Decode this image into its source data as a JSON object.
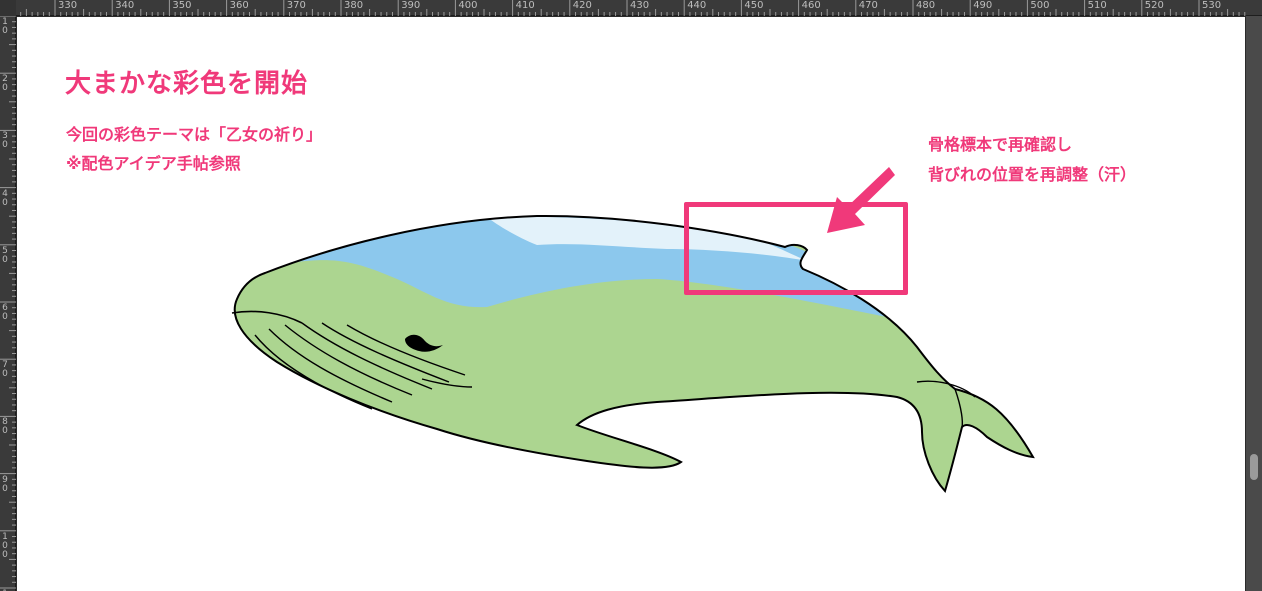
{
  "ruler": {
    "top_labels": [
      "330",
      "340",
      "350",
      "360",
      "370",
      "380",
      "390",
      "400",
      "410",
      "420",
      "430",
      "440",
      "450",
      "460",
      "470",
      "480",
      "490",
      "500",
      "510",
      "520",
      "530"
    ],
    "left_labels": [
      "1\n0",
      "2\n0",
      "3\n0",
      "4\n0",
      "5\n0",
      "6\n0",
      "7\n0",
      "8\n0",
      "9\n0",
      "1\n0\n0",
      "1\n1"
    ]
  },
  "annotation": {
    "title": "大まかな彩色を開始",
    "line1": "今回の彩色テーマは「乙女の祈り」",
    "line2": "※配色アイデア手帖参照"
  },
  "note": {
    "line1": "骨格標本で再確認し",
    "line2": "背びれの位置を再調整（汗）"
  },
  "colors": {
    "accent": "#f0397a",
    "whale_body": "#acd590",
    "whale_back": "#8cc8ed",
    "whale_highlight": "#e3f2fa",
    "outline": "#000000"
  },
  "icons": {
    "arrow": "arrow-pointing-down-left-icon"
  }
}
